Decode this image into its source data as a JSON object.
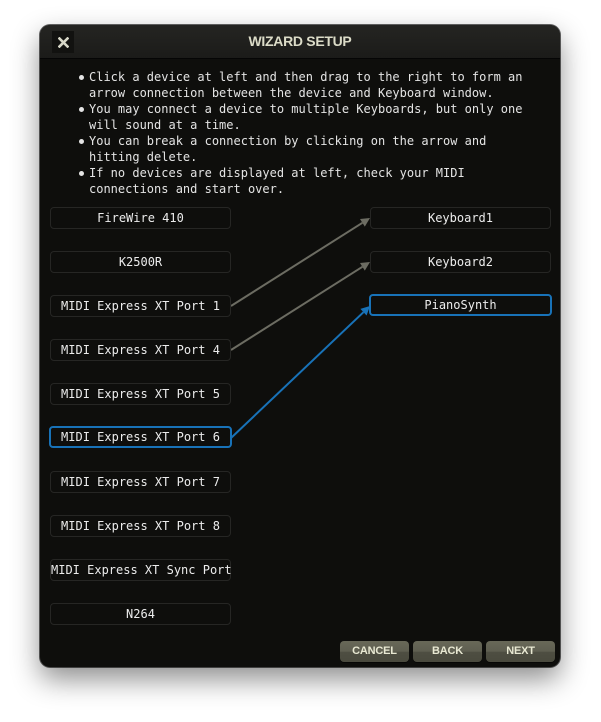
{
  "window": {
    "title": "WIZARD SETUP",
    "close_icon": "close-x-icon"
  },
  "instructions": [
    "Click a device at left and then drag to the right to form an arrow connection between the device and Keyboard window.",
    "You may connect a device to multiple Keyboards, but only one will sound at a time.",
    "You can break a connection by clicking on the arrow and hitting delete.",
    "If no devices are displayed at left, check your MIDI connections and start over."
  ],
  "devices": [
    {
      "label": "FireWire 410",
      "selected": false
    },
    {
      "label": "K2500R",
      "selected": false
    },
    {
      "label": "MIDI Express XT Port 1",
      "selected": false
    },
    {
      "label": "MIDI Express XT Port 4",
      "selected": false
    },
    {
      "label": "MIDI Express XT Port 5",
      "selected": false
    },
    {
      "label": "MIDI Express XT Port 6",
      "selected": true
    },
    {
      "label": "MIDI Express XT Port 7",
      "selected": false
    },
    {
      "label": "MIDI Express XT Port 8",
      "selected": false
    },
    {
      "label": "MIDI Express XT Sync Port",
      "selected": false
    },
    {
      "label": "N264",
      "selected": false
    }
  ],
  "keyboards": [
    {
      "label": "Keyboard1",
      "selected": false
    },
    {
      "label": "Keyboard2",
      "selected": false
    },
    {
      "label": "PianoSynth",
      "selected": true
    }
  ],
  "connections": [
    {
      "from": "MIDI Express XT Port 1",
      "to": "Keyboard1",
      "selected": false
    },
    {
      "from": "MIDI Express XT Port 4",
      "to": "Keyboard2",
      "selected": false
    },
    {
      "from": "MIDI Express XT Port 6",
      "to": "PianoSynth",
      "selected": true
    }
  ],
  "colors": {
    "selected": "#1872b8",
    "connection": "#6c6c62"
  },
  "buttons": {
    "cancel": "CANCEL",
    "back": "BACK",
    "next": "NEXT"
  }
}
